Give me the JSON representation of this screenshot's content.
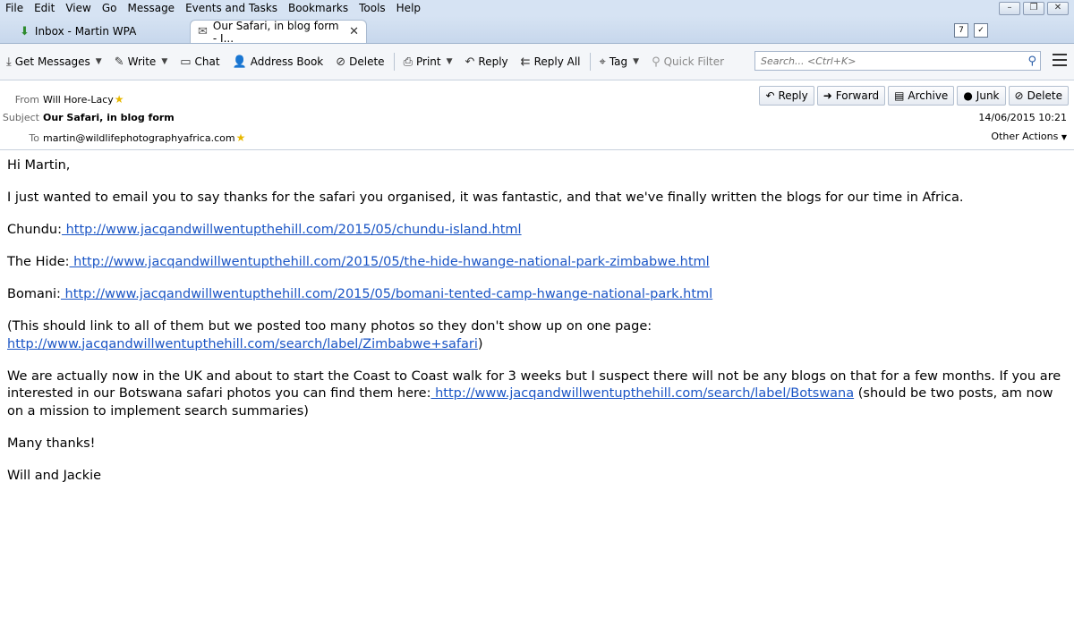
{
  "menu": [
    "File",
    "Edit",
    "View",
    "Go",
    "Message",
    "Events and Tasks",
    "Bookmarks",
    "Tools",
    "Help"
  ],
  "tabs": [
    {
      "label": "Inbox - Martin WPA"
    },
    {
      "label": "Our Safari, in blog form - I..."
    }
  ],
  "toolbar": {
    "get_messages": "Get Messages",
    "write": "Write",
    "chat": "Chat",
    "address_book": "Address Book",
    "delete": "Delete",
    "print": "Print",
    "reply": "Reply",
    "reply_all": "Reply All",
    "tag": "Tag",
    "quick_filter": "Quick Filter",
    "search_placeholder": "Search... <Ctrl+K>"
  },
  "header": {
    "from_label": "From",
    "from": "Will Hore-Lacy",
    "subject_label": "Subject",
    "subject": "Our Safari, in blog form",
    "to_label": "To",
    "to": "martin@wildlifephotographyafrica.com",
    "date": "14/06/2015 10:21",
    "other_actions": "Other Actions",
    "buttons": {
      "reply": "Reply",
      "forward": "Forward",
      "archive": "Archive",
      "junk": "Junk",
      "delete": "Delete"
    }
  },
  "message": {
    "greeting": "Hi Martin,",
    "intro": "I just wanted to email you to say thanks for the safari you organised, it was fantastic, and that we've finally written the blogs for our time in Africa.",
    "chundu_label": "Chundu:",
    "chundu_link": " http://www.jacqandwillwentupthehill.com/2015/05/chundu-island.html",
    "hide_label": "The Hide:",
    "hide_link": " http://www.jacqandwillwentupthehill.com/2015/05/the-hide-hwange-national-park-zimbabwe.html",
    "bomani_label": "Bomani:",
    "bomani_link": " http://www.jacqandwillwentupthehill.com/2015/05/bomani-tented-camp-hwange-national-park.html",
    "all_prefix": "(This should link to all of them but we posted too many photos so they don't show up on one page:",
    "all_link": " http://www.jacqandwillwentupthehill.com/search/label/Zimbabwe+safari",
    "all_suffix": ")",
    "uk_prefix": "We are actually now in the UK and about to start the Coast to Coast walk for 3 weeks but I suspect there will not be any blogs on that for a few months.  If you are interested in our Botswana safari photos you can find them here:",
    "uk_link": " http://www.jacqandwillwentupthehill.com/search/label/Botswana",
    "uk_suffix": " (should be two posts, am now on a mission to implement search summaries)",
    "thanks": "Many thanks!",
    "signature": "Will and Jackie"
  }
}
